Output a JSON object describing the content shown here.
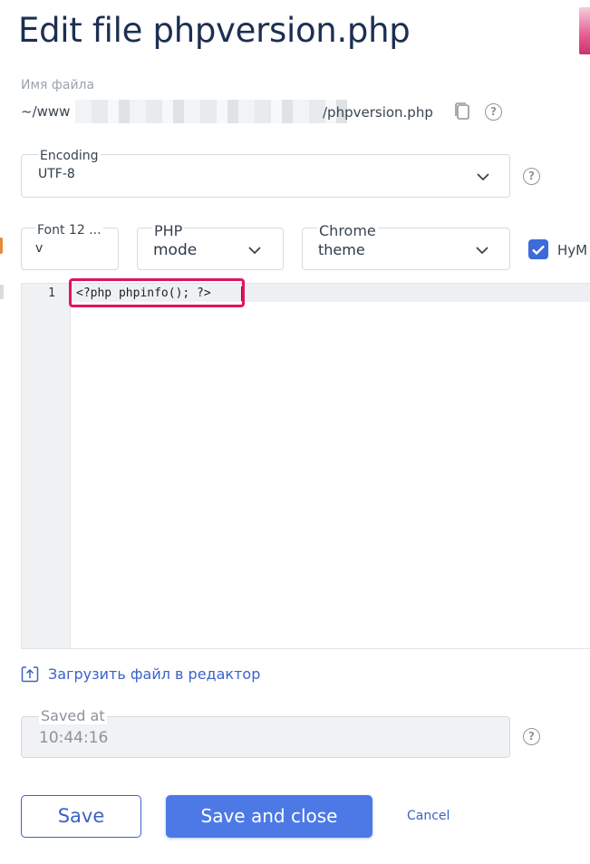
{
  "dialog": {
    "title": "Edit file phpversion.php"
  },
  "filename": {
    "label": "Имя файла",
    "path_start": "~/www",
    "path_end": "/phpversion.php",
    "copy_icon": "copy-icon",
    "help": "?"
  },
  "encoding": {
    "label": "Encoding",
    "value": "UTF-8",
    "help": "?"
  },
  "font": {
    "label": "Font 12 ...",
    "value": "v"
  },
  "mode": {
    "label": "PHP",
    "value": "mode"
  },
  "theme": {
    "label": "Chrome",
    "value": "theme"
  },
  "numbers_checkbox": {
    "label": "НуМ",
    "checked": true
  },
  "editor": {
    "lines": [
      {
        "number": "1",
        "code": "<?php phpinfo(); ?>"
      }
    ]
  },
  "upload": {
    "label": "Загрузить файл в редактор",
    "icon": "upload-icon"
  },
  "saved": {
    "label": "Saved at",
    "value": "10:44:16",
    "help": "?"
  },
  "buttons": {
    "save": "Save",
    "save_close": "Save and close",
    "cancel": "Cancel"
  },
  "colors": {
    "accent": "#3b62c9",
    "primary_button": "#4c79e6",
    "highlight": "#e0155f",
    "title": "#1d2f52"
  }
}
